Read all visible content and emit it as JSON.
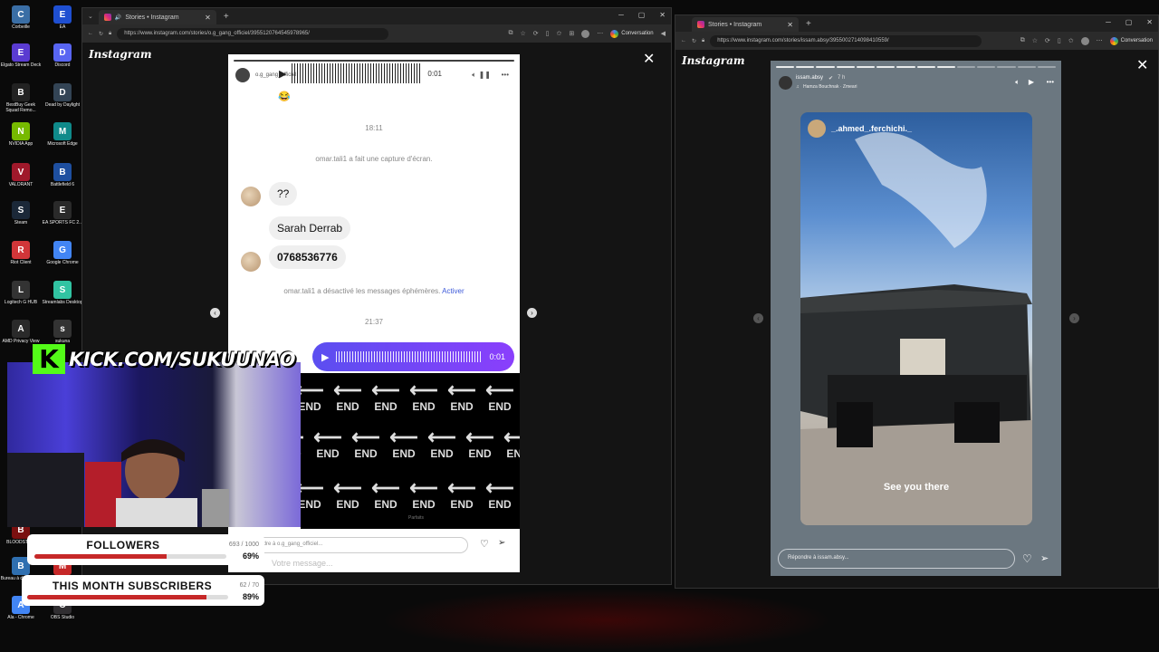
{
  "desktop": {
    "icons": [
      {
        "label": "Corbeille",
        "icon": "trash-icon",
        "color": "#3a6ea5"
      },
      {
        "label": "EA",
        "icon": "ea-icon",
        "color": "#1f4fd1"
      },
      {
        "label": "Elgato Stream Deck",
        "icon": "stream-deck-icon",
        "color": "#5a3bd1"
      },
      {
        "label": "Discord",
        "icon": "discord-icon",
        "color": "#5865f2"
      },
      {
        "label": "BestBuy Geek Squad Remo...",
        "icon": "geek-squad-icon",
        "color": "#222222"
      },
      {
        "label": "Dead by Daylight",
        "icon": "dbd-icon",
        "color": "#334455"
      },
      {
        "label": "NVIDIA App",
        "icon": "nvidia-icon",
        "color": "#76b900"
      },
      {
        "label": "Microsoft Edge",
        "icon": "edge-icon",
        "color": "#0f8a8a"
      },
      {
        "label": "VALORANT",
        "icon": "valorant-icon",
        "color": "#a0192b"
      },
      {
        "label": "Battlefield 6",
        "icon": "battlefield-icon",
        "color": "#1e4fa0"
      },
      {
        "label": "Steam",
        "icon": "steam-icon",
        "color": "#1b2838"
      },
      {
        "label": "EA SPORTS FC 2...",
        "icon": "ea-fc-icon",
        "color": "#2a2a2a"
      },
      {
        "label": "Riot Client",
        "icon": "riot-icon",
        "color": "#d13639"
      },
      {
        "label": "Google Chrome",
        "icon": "chrome-icon",
        "color": "#4285f4"
      },
      {
        "label": "Logitech G HUB",
        "icon": "ghub-icon",
        "color": "#333333"
      },
      {
        "label": "Streamlabs Desktop",
        "icon": "streamlabs-icon",
        "color": "#31c3a2"
      },
      {
        "label": "AMD Privacy View",
        "icon": "amd-icon",
        "color": "#2a2a2a"
      },
      {
        "label": "sukuna",
        "icon": "folder-icon",
        "color": "#333333"
      },
      {
        "label": "BLOODSTR...",
        "icon": "bloodstrike-icon",
        "color": "#7a1010"
      },
      {
        "label": "Bureau à distance...",
        "icon": "remote-desktop-icon",
        "color": "#2f6fb0"
      },
      {
        "label": "MEGA...",
        "icon": "mega-icon",
        "color": "#c62828"
      },
      {
        "label": "Ala - Chrome",
        "icon": "chrome-icon",
        "color": "#4285f4"
      },
      {
        "label": "OBS Studio",
        "icon": "obs-icon",
        "color": "#302e31"
      }
    ]
  },
  "browser1": {
    "tab_title": "Stories • Instagram",
    "url": "https://www.instagram.com/stories/o.g_gang_officiel/3955120764545978965/",
    "conversation_label": "Conversation",
    "logo": "Instagram",
    "story": {
      "username": "o.g_gang_officiel",
      "voice_top_duration": "0:01",
      "emoji": "😂",
      "time1": "18:11",
      "screenshot_notice": "omar.tali1 a fait une capture d'écran.",
      "msg_q": "??",
      "msg_name": "Sarah Derrab",
      "msg_phone": "0768536776",
      "ephemeral_notice": "omar.tali1 a désactivé les messages éphémères.",
      "ephemeral_action": "Activer",
      "time2": "21:37",
      "voice_out_duration": "0:01",
      "end_label": "END",
      "reply_placeholder": "Répondre à o.g_gang_officiel...",
      "bottom_input": "Votre message...",
      "sent_label": "Parfaits"
    }
  },
  "browser2": {
    "tab_title": "Stories • Instagram",
    "url": "https://www.instagram.com/stories/issam.absy/3955002714098410559/",
    "conversation_label": "Conversation",
    "logo": "Instagram",
    "story": {
      "username": "issam.absy",
      "time_ago": "7 h",
      "music": "Hamza Bouchnak · Zmeari",
      "reshared_user": "_.ahmed_.ferchichi._",
      "caption": "See you there",
      "reply_placeholder": "Répondre à issam.absy..."
    }
  },
  "stream_overlay": {
    "kick_logo": "K",
    "kick_url": "KICK.COM/SUKUUNAO",
    "followers_goal": {
      "title": "FOLLOWERS",
      "count": "693 / 1000",
      "percent_label": "69%",
      "percent": 69
    },
    "subs_goal": {
      "title": "THIS MONTH SUBSCRIBERS",
      "count": "62 / 70",
      "percent_label": "89%",
      "percent": 89
    }
  },
  "colors": {
    "instagram_purple": "#7c4dff",
    "kick_green": "#53fc18",
    "goal_red": "#c62828",
    "link_blue": "#3d5ad9"
  }
}
